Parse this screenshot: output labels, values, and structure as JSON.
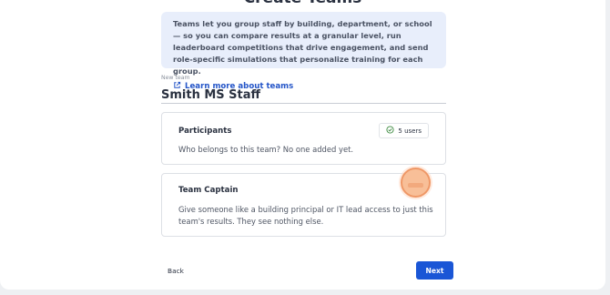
{
  "page": {
    "title": "Create Teams"
  },
  "info": {
    "text": "Teams let you group staff by building, department, or school — so you can compare results at a granular level, run leaderboard competitions that drive engagement, and send role-specific simulations that personalize training for each group.",
    "link_label": "Learn more about teams",
    "link_icon": "external-link-icon"
  },
  "team_name": {
    "label": "New team",
    "value": "Smith MS Staff"
  },
  "participants": {
    "title": "Participants",
    "users_label": "5 users",
    "users_icon": "check-circle-icon",
    "description": "Who belongs to this team? No one added yet."
  },
  "captain": {
    "title": "Team Captain",
    "description": "Give someone like a building principal or IT lead access to just this team's results. They see nothing else."
  },
  "footer": {
    "back_label": "Back",
    "next_label": "Next"
  },
  "colors": {
    "accent": "#1a56d6",
    "info_bg": "#e8eefb",
    "cursor_highlight": "#f8bf98"
  }
}
